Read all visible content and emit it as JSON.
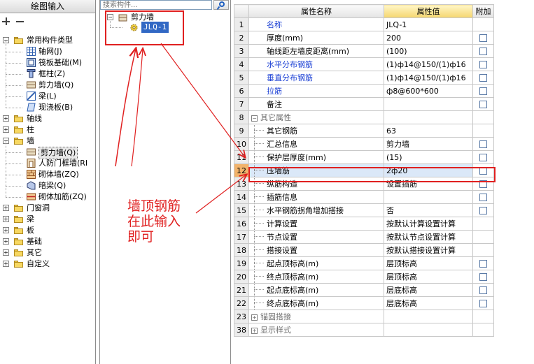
{
  "left_panel": {
    "title": "绘图输入",
    "tree": [
      {
        "label": "常用构件类型",
        "icon": "folder-open-icon"
      },
      {
        "label": "轴网(J)",
        "icon": "grid-icon"
      },
      {
        "label": "筏板基础(M)",
        "icon": "raft-foundation-icon"
      },
      {
        "label": "框柱(Z)",
        "icon": "column-icon"
      },
      {
        "label": "剪力墙(Q)",
        "icon": "shear-wall-icon"
      },
      {
        "label": "梁(L)",
        "icon": "beam-icon"
      },
      {
        "label": "现浇板(B)",
        "icon": "slab-icon"
      },
      {
        "label": "轴线",
        "icon": "folder-icon"
      },
      {
        "label": "柱",
        "icon": "folder-icon"
      },
      {
        "label": "墙",
        "icon": "folder-open-icon"
      },
      {
        "label": "剪力墙(Q)",
        "icon": "shear-wall-icon"
      },
      {
        "label": "人防门框墙(RI",
        "icon": "door-frame-wall-icon"
      },
      {
        "label": "砌体墙(ZQ)",
        "icon": "masonry-wall-icon"
      },
      {
        "label": "暗梁(Q)",
        "icon": "hidden-beam-icon"
      },
      {
        "label": "砌体加筋(ZQ)",
        "icon": "masonry-rebar-icon"
      },
      {
        "label": "门窗洞",
        "icon": "folder-icon"
      },
      {
        "label": "梁",
        "icon": "folder-icon"
      },
      {
        "label": "板",
        "icon": "folder-icon"
      },
      {
        "label": "基础",
        "icon": "folder-icon"
      },
      {
        "label": "其它",
        "icon": "folder-icon"
      },
      {
        "label": "自定义",
        "icon": "folder-icon"
      }
    ]
  },
  "mid_panel": {
    "search_placeholder": "搜索构件...",
    "tree_root": "剪力墙",
    "tree_child": "JLQ-1"
  },
  "property_grid": {
    "headers": {
      "name": "属性名称",
      "value": "属性值",
      "extra": "附加"
    },
    "rows": [
      {
        "no": "1",
        "name": "名称",
        "value": "JLQ-1",
        "blue": true,
        "check": false
      },
      {
        "no": "2",
        "name": "厚度(mm)",
        "value": "200",
        "blue": false,
        "check": true
      },
      {
        "no": "3",
        "name": "轴线距左墙皮距离(mm)",
        "value": "(100)",
        "blue": false,
        "check": true
      },
      {
        "no": "4",
        "name": "水平分布钢筋",
        "value": "(1)ф14@150/(1)ф16",
        "blue": true,
        "check": true
      },
      {
        "no": "5",
        "name": "垂直分布钢筋",
        "value": "(1)ф14@150/(1)ф16",
        "blue": true,
        "check": true
      },
      {
        "no": "6",
        "name": "拉筋",
        "value": "ф8@600*600",
        "blue": true,
        "check": true
      },
      {
        "no": "7",
        "name": "备注",
        "value": "",
        "blue": false,
        "check": true
      },
      {
        "no": "8",
        "name": "其它属性",
        "value": "",
        "group": "−",
        "check": false
      },
      {
        "no": "9",
        "name": "其它钢筋",
        "value": "63",
        "indent": true,
        "check": false
      },
      {
        "no": "10",
        "name": "汇总信息",
        "value": "剪力墙",
        "indent": true,
        "check": true
      },
      {
        "no": "11",
        "name": "保护层厚度(mm)",
        "value": "(15)",
        "indent": true,
        "check": true
      },
      {
        "no": "12",
        "name": "压墙筋",
        "value": "2ф20",
        "indent": true,
        "check": true,
        "selected": true
      },
      {
        "no": "13",
        "name": "纵筋构造",
        "value": "设置插筋",
        "indent": true,
        "check": true
      },
      {
        "no": "14",
        "name": "插筋信息",
        "value": "",
        "indent": true,
        "check": true
      },
      {
        "no": "15",
        "name": "水平钢筋拐角增加搭接",
        "value": "否",
        "indent": true,
        "check": true
      },
      {
        "no": "16",
        "name": "计算设置",
        "value": "按默认计算设置计算",
        "indent": true,
        "check": false
      },
      {
        "no": "17",
        "name": "节点设置",
        "value": "按默认节点设置计算",
        "indent": true,
        "check": false
      },
      {
        "no": "18",
        "name": "搭接设置",
        "value": "按默认搭接设置计算",
        "indent": true,
        "check": false
      },
      {
        "no": "19",
        "name": "起点顶标高(m)",
        "value": "层顶标高",
        "indent": true,
        "check": true
      },
      {
        "no": "20",
        "name": "终点顶标高(m)",
        "value": "层顶标高",
        "indent": true,
        "check": true
      },
      {
        "no": "21",
        "name": "起点底标高(m)",
        "value": "层底标高",
        "indent": true,
        "check": true
      },
      {
        "no": "22",
        "name": "终点底标高(m)",
        "value": "层底标高",
        "indent": true,
        "check": true
      },
      {
        "no": "23",
        "name": "锚固搭接",
        "value": "",
        "group": "+",
        "check": false
      },
      {
        "no": "38",
        "name": "显示样式",
        "value": "",
        "group": "+",
        "check": false
      }
    ]
  },
  "annotation": {
    "line1": "墙顶钢筋",
    "line2": "在此输入",
    "line3": "即可",
    "color": "#e02020"
  }
}
